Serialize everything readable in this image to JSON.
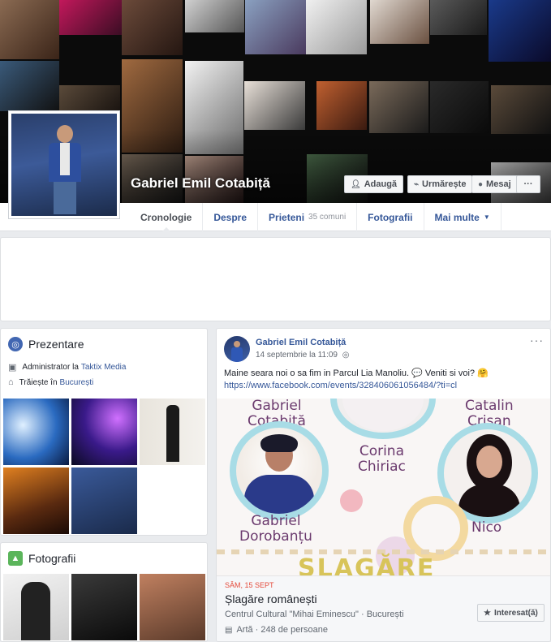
{
  "profile": {
    "name": "Gabriel Emil Cotabiță",
    "buttons": {
      "add_friend": "Adaugă",
      "follow": "Urmărește",
      "message": "Mesaj",
      "more": "···"
    }
  },
  "tabs": [
    {
      "label": "Cronologie"
    },
    {
      "label": "Despre"
    },
    {
      "label": "Prieteni",
      "sub": "35 comuni"
    },
    {
      "label": "Fotografii"
    },
    {
      "label": "Mai multe",
      "caret": "▼"
    }
  ],
  "intro": {
    "title": "Prezentare",
    "work_prefix": "Administrator la",
    "work_link": "Taktix Media",
    "lives_prefix": "Trăiește în",
    "lives_link": "București"
  },
  "photos": {
    "title": "Fotografii"
  },
  "post": {
    "author": "Gabriel Emil Cotabiță",
    "time": "14 septembrie la 11:09",
    "privacy_icon": "globe-icon",
    "more": "···",
    "text": "Maine seara noi o sa fim in Parcul Lia Manoliu. 💬 Veniti si voi? 🤗",
    "link": "https://www.facebook.com/events/328406061056484/?ti=cl",
    "poster": {
      "names": {
        "gabriel_top": "Gabriel\nCotabiță",
        "corina": "Corina\nChiriac",
        "catalin": "Catalin\nCrișan",
        "gabriel_dob": "Gabriel\nDorobanțu",
        "nico": "Nico"
      },
      "headline": "ȘLAGĂRE"
    },
    "event": {
      "date": "SÂM, 15 SEPT",
      "title": "Șlagăre românești",
      "place": "Centrul Cultural \"Mihai Eminescu\" · București",
      "meta": "Artă · 248 de persoane",
      "interested_label": "Interesat(ă)"
    }
  },
  "colors": {
    "link": "#365899",
    "page_bg": "#e9ebee",
    "event_date": "#e44a3a"
  }
}
